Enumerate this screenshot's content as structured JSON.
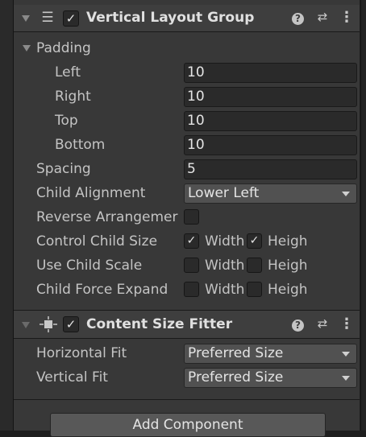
{
  "vertical_layout_group": {
    "title": "Vertical Layout Group",
    "enabled": true,
    "icons": {
      "component": "list-layout-icon",
      "help": "help-icon",
      "presets": "presets-icon",
      "menu": "kebab-menu-icon"
    },
    "padding": {
      "label": "Padding",
      "left_label": "Left",
      "left_value": "10",
      "right_label": "Right",
      "right_value": "10",
      "top_label": "Top",
      "top_value": "10",
      "bottom_label": "Bottom",
      "bottom_value": "10"
    },
    "spacing_label": "Spacing",
    "spacing_value": "5",
    "child_alignment_label": "Child Alignment",
    "child_alignment_value": "Lower Left",
    "reverse_arrangement_label": "Reverse Arrangemer",
    "reverse_arrangement_checked": false,
    "control_child_size_label": "Control Child Size",
    "control_child_size_width_label": "Width",
    "control_child_size_width_checked": true,
    "control_child_size_height_label": "Heigh",
    "control_child_size_height_checked": true,
    "use_child_scale_label": "Use Child Scale",
    "use_child_scale_width_label": "Width",
    "use_child_scale_width_checked": false,
    "use_child_scale_height_label": "Heigh",
    "use_child_scale_height_checked": false,
    "child_force_expand_label": "Child Force Expand",
    "child_force_expand_width_label": "Width",
    "child_force_expand_width_checked": false,
    "child_force_expand_height_label": "Heigh",
    "child_force_expand_height_checked": false
  },
  "content_size_fitter": {
    "title": "Content Size Fitter",
    "enabled": true,
    "icons": {
      "component": "fit-arrows-icon",
      "help": "help-icon",
      "presets": "presets-icon",
      "menu": "kebab-menu-icon"
    },
    "horizontal_fit_label": "Horizontal Fit",
    "horizontal_fit_value": "Preferred Size",
    "vertical_fit_label": "Vertical Fit",
    "vertical_fit_value": "Preferred Size"
  },
  "add_component_label": "Add Component",
  "symbols": {
    "help": "?",
    "menu": "⋮",
    "presets": "⇄",
    "check": "✓",
    "list": "☰"
  }
}
